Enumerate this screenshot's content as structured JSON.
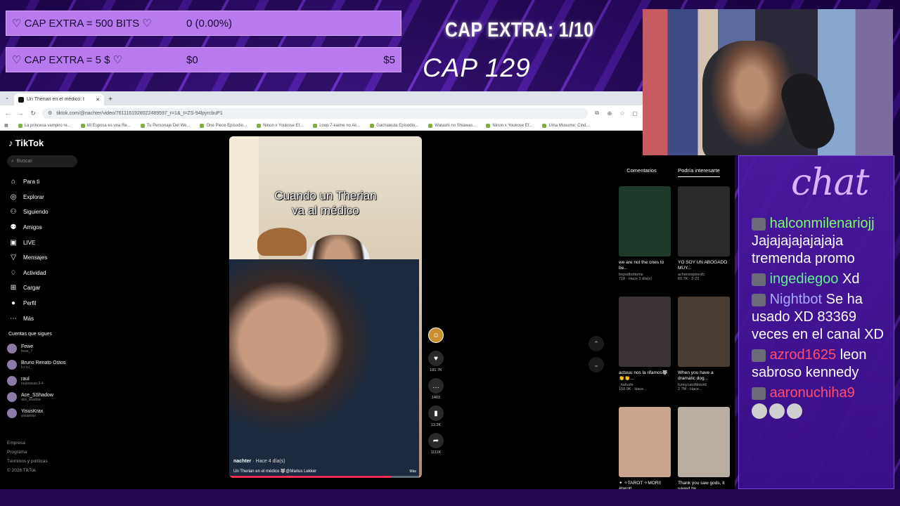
{
  "goals": [
    {
      "label": "♡ CAP EXTRA = 500 BITS ♡",
      "value": "0 (0.00%)",
      "target": ""
    },
    {
      "label": "♡ CAP EXTRA = 5 $ ♡",
      "value": "$0",
      "target": "$5"
    }
  ],
  "overlay": {
    "cap_extra": "CAP EXTRA: 1/10",
    "cap": "CAP 129"
  },
  "browser": {
    "tab_title": "Un Therian en el médico: t",
    "new_tab": "+",
    "url": "tiktok.com/@nachter/video/7611161928022489597_r=1&_t=ZS-94lpyrcbuP1",
    "bookmarks": [
      "La princesa vampiro re...",
      "Mi Esposa es una Re...",
      "Tu Personaje Del We...",
      "One Piece Episodio...",
      "Ninon x Youkose Ef...",
      "Loop 7-kaime no Ak...",
      "Gachiakuta Episodio...",
      "Watashi no Shiawas...",
      "Ninon x Youkose Ef...",
      "Uma Musume: Cind..."
    ]
  },
  "tiktok": {
    "logo": "TikTok",
    "search_placeholder": "Buscar",
    "nav": [
      {
        "label": "Para ti",
        "icon": "home-icon",
        "glyph": "⌂"
      },
      {
        "label": "Explorar",
        "icon": "compass-icon",
        "glyph": "◎"
      },
      {
        "label": "Siguiendo",
        "icon": "following-icon",
        "glyph": "⚇"
      },
      {
        "label": "Amigos",
        "icon": "friends-icon",
        "glyph": "⚉"
      },
      {
        "label": "LIVE",
        "icon": "live-icon",
        "glyph": "▣"
      },
      {
        "label": "Mensajes",
        "icon": "messages-icon",
        "glyph": "▽"
      },
      {
        "label": "Actividad",
        "icon": "activity-icon",
        "glyph": "♢"
      },
      {
        "label": "Cargar",
        "icon": "upload-icon",
        "glyph": "⊞"
      },
      {
        "label": "Perfil",
        "icon": "profile-icon",
        "glyph": "●"
      },
      {
        "label": "Más",
        "icon": "more-icon",
        "glyph": "⋯"
      }
    ],
    "following_title": "Cuentas que sigues",
    "following": [
      {
        "name": "Fewe",
        "handle": "fewe_7"
      },
      {
        "name": "Bruno Renato Ostos",
        "handle": "b.r.o.i_"
      },
      {
        "name": "raul",
        "handle": "raulinasao.3-4"
      },
      {
        "name": "Ace_SShadow",
        "handle": "ace_shadow"
      },
      {
        "name": "YisusKrax",
        "handle": "yisuskrax"
      }
    ],
    "footer": [
      "Empresa",
      "Programa",
      "Términos y políticas",
      "© 2026 TikTok"
    ],
    "video": {
      "caption_line1": "Cuando un Therian",
      "caption_line2": "va al médico",
      "author": "nachter",
      "posted": "· Hace 4 día(s)",
      "description": "Un Therian en el médico 🐺@Marius Lekker",
      "hd": "Más",
      "progress": 0.84
    },
    "actions": [
      {
        "icon": "like-icon",
        "glyph": "♥",
        "count": "181.7K"
      },
      {
        "icon": "comment-icon",
        "glyph": "…",
        "count": "1403"
      },
      {
        "icon": "bookmark-icon",
        "glyph": "▮",
        "count": "13.2K"
      },
      {
        "icon": "share-icon",
        "glyph": "➦",
        "count": "1111K"
      }
    ],
    "recommend_tabs": [
      "Comentarios",
      "Podría interesarte"
    ],
    "recommend": [
      {
        "title": "we are not the ones to be...",
        "author": "bopsdbottoms",
        "meta": "718 · Hace 3 día(s)",
        "color": "#1e3a2a"
      },
      {
        "title": "YO SOY UN ABOGADO MUY...",
        "author": "acherorsptorofc",
        "meta": "60.7K · 2-22",
        "color": "#2b2b2b"
      },
      {
        "title": "actuuu nos la rifamos🐺👏👏...",
        "author": "_itafushi",
        "meta": "158.9K · Hace...",
        "color": "#3a3233"
      },
      {
        "title": "When you have a dramatic dog...",
        "author": "funnycatoftiktok6",
        "meta": "2.7M · Hace...",
        "color": "#4a3d33"
      },
      {
        "title": "✦ ✧TAROT ✧MORI! #tarot!...",
        "author": "",
        "meta": "",
        "color": "#c9a48f"
      },
      {
        "title": "Thank you saw gods, it saved by...",
        "author": "",
        "meta": "",
        "color": "#b9aea1"
      }
    ]
  },
  "chat": {
    "title": "chat",
    "messages": [
      {
        "user": "halconmilenariojj",
        "text": "Jajajajajajajaja tremenda promo",
        "color": "#7dfc6a"
      },
      {
        "user": "ingediegoo",
        "text": "Xd",
        "color": "#62f08f"
      },
      {
        "user": "Nightbot",
        "text": "Se ha usado XD 83369 veces en el canal XD",
        "color": "#a9a9ff"
      },
      {
        "user": "azrod1625",
        "text": "leon sabroso kennedy",
        "color": "#ff4d6d"
      },
      {
        "user": "aaronuchiha9",
        "text": "",
        "color": "#ff4d6d"
      }
    ]
  }
}
